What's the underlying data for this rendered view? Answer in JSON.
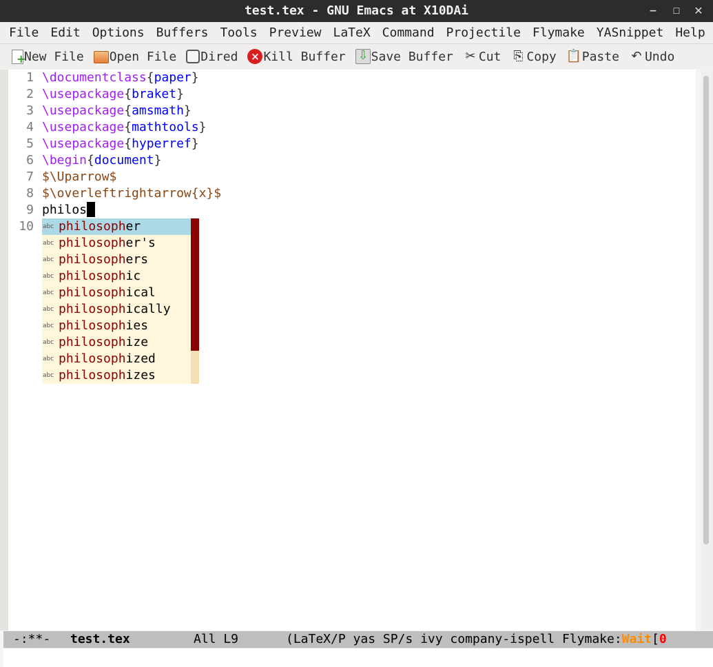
{
  "window": {
    "title": "test.tex - GNU Emacs at X10DAi"
  },
  "menu": [
    "File",
    "Edit",
    "Options",
    "Buffers",
    "Tools",
    "Preview",
    "LaTeX",
    "Command",
    "Projectile",
    "Flymake",
    "YASnippet",
    "Help"
  ],
  "toolbar": {
    "new_file": "New File",
    "open_file": "Open File",
    "dired": "Dired",
    "kill_buffer": "Kill Buffer",
    "save_buffer": "Save Buffer",
    "cut": "Cut",
    "copy": "Copy",
    "paste": "Paste",
    "undo": "Undo"
  },
  "editor": {
    "lines": [
      {
        "n": "1",
        "cmd": "\\documentclass",
        "arg": "paper"
      },
      {
        "n": "2",
        "cmd": "\\usepackage",
        "arg": "braket"
      },
      {
        "n": "3",
        "cmd": "\\usepackage",
        "arg": "amsmath"
      },
      {
        "n": "4",
        "cmd": "\\usepackage",
        "arg": "mathtools"
      },
      {
        "n": "5",
        "cmd": "\\usepackage",
        "arg": "hyperref"
      },
      {
        "n": "6",
        "cmd": "\\begin",
        "arg": "document"
      },
      {
        "n": "7",
        "math": "$\\Uparrow$"
      },
      {
        "n": "8",
        "math": "$\\overleftrightarrow{x}$"
      },
      {
        "n": "9",
        "plain": "philos"
      },
      {
        "n": "10"
      }
    ]
  },
  "completion": {
    "kind_label": "abc",
    "common_prefix": "philosoph",
    "candidates": [
      {
        "rest": "er",
        "selected": true
      },
      {
        "rest": "er's"
      },
      {
        "rest": "ers"
      },
      {
        "rest": "ic"
      },
      {
        "rest": "ical"
      },
      {
        "rest": "ically"
      },
      {
        "rest": "ies"
      },
      {
        "rest": "ize"
      },
      {
        "rest": "ized"
      },
      {
        "rest": "izes"
      }
    ]
  },
  "modeline": {
    "status": "-:**-",
    "buffer": "test.tex",
    "position": "All L9",
    "modes": "(LaTeX/P yas SP/s ivy company-ispell Flymake:",
    "flymake_state": "Wait",
    "bracket": "[",
    "errors": "0"
  },
  "colors": {
    "keyword": "#a020f0",
    "argument": "#0000ff",
    "math": "#8b4513",
    "match": "#8b0000",
    "selection": "#add8e6",
    "popup_bg": "#fff6dc"
  }
}
